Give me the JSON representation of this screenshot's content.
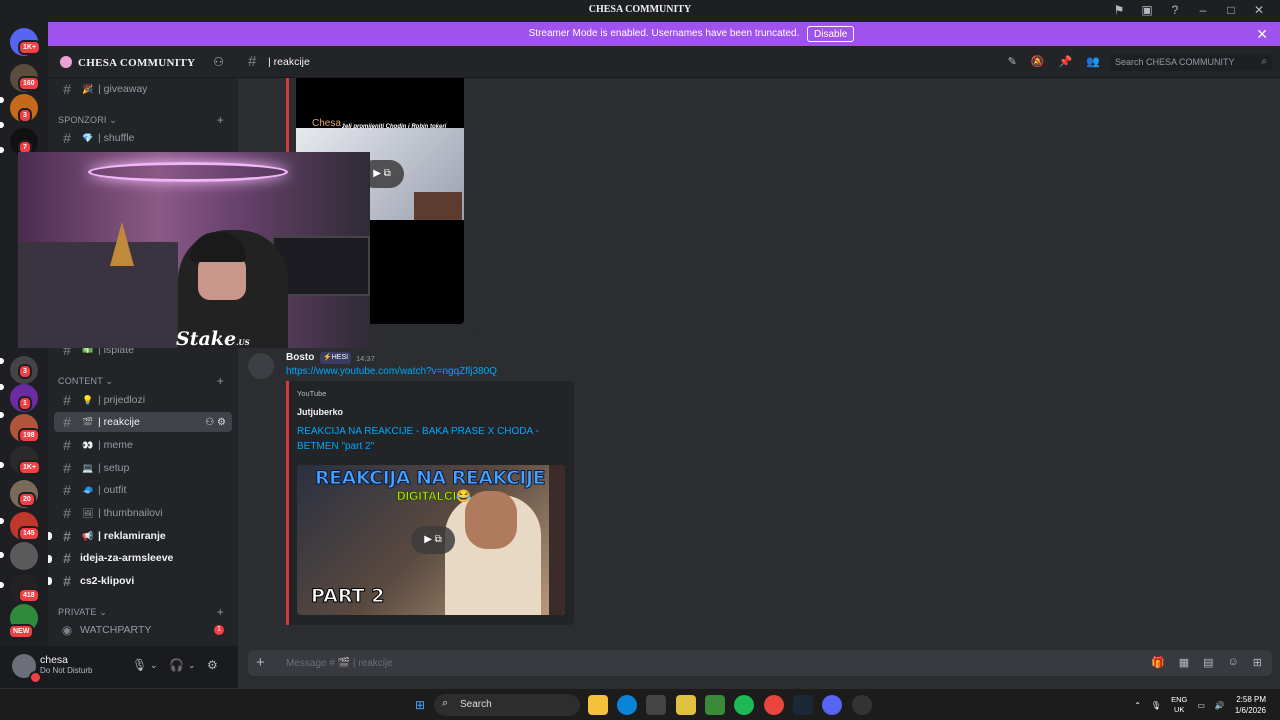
{
  "window": {
    "title": "CHESA COMMUNITY"
  },
  "streamer_bar": {
    "message": "Streamer Mode is enabled. Usernames have been truncated.",
    "disable_label": "Disable"
  },
  "rail": {
    "badges": [
      "1K+",
      "160",
      "3",
      "7",
      "3",
      "1",
      "198",
      "1K+",
      "20",
      "145",
      "418",
      "NEW"
    ]
  },
  "guild": {
    "name": "CHESA COMMUNITY"
  },
  "channels": {
    "giveaway": "| giveaway",
    "cat_sponzori": "SPONZORI",
    "shuffle": "| shuffle",
    "isplate": "| isplate",
    "cat_content": "CONTENT",
    "prijedlozi": "| prijedlozi",
    "reakcije": "| reakcije",
    "meme": "| meme",
    "setup": "| setup",
    "outfit": "| outfit",
    "thumbnailovi": "| thumbnailovi",
    "reklamiranje": "| reklamiranje",
    "armsleeve": "ideja-za-armsleeve",
    "cs2": "cs2-klipovi",
    "cat_private": "PRIVATE",
    "watchparty": "WATCHPARTY",
    "watchparty_count": "1"
  },
  "user": {
    "name": "chesa",
    "status": "Do Not Disturb"
  },
  "header": {
    "channel": "| reakcije",
    "search_placeholder": "Search CHESA COMMUNITY"
  },
  "top_embed": {
    "chesa_text": "Chesa",
    "caption": "želi promijeniti Chodin i Robin tokeri"
  },
  "webcam": {
    "sponsor": "Stake",
    "sponsor_sub": ".US"
  },
  "message": {
    "author": "Bosto",
    "role_tag": "HESI",
    "time": "14:37",
    "link": "https://www.youtube.com/watch?v=ngqZflj380Q",
    "embed": {
      "provider": "YouTube",
      "author": "Jutjuberko",
      "title": "REAKCIJA NA REAKCIJE - BAKA PRASE X CHODA - BETMEN \"part 2\"",
      "thumb_line1": "REAKCIJA NA REAKCIJE",
      "thumb_line2": "DIGITALCI😂",
      "thumb_line3": "PART 2"
    }
  },
  "composer": {
    "placeholder": "Message # 🎬 | reakcije"
  },
  "taskbar": {
    "search": "Search",
    "lang1": "ENG",
    "lang2": "UK",
    "time": "2:58 PM",
    "date": "1/6/2026"
  }
}
